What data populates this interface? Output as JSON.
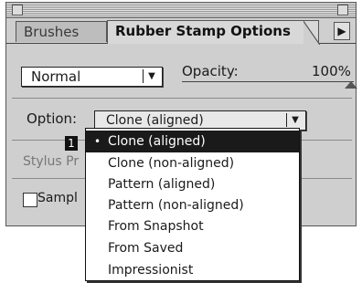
{
  "tabs": [
    {
      "label": "Brushes"
    },
    {
      "label": "Rubber Stamp Options"
    }
  ],
  "tab_scroll_icon": "right-triangle-icon",
  "blend_mode": {
    "value": "Normal"
  },
  "opacity": {
    "label": "Opacity:",
    "value": "100%"
  },
  "option": {
    "label": "Option:",
    "value": "Clone (aligned)"
  },
  "stylus": {
    "label": "Stylus Pr",
    "badge": "1"
  },
  "sample": {
    "label": "Sampl",
    "checked": false
  },
  "menu": {
    "bullet": "•",
    "items": [
      "Clone (aligned)",
      "Clone (non-aligned)",
      "Pattern (aligned)",
      "Pattern (non-aligned)",
      "From Snapshot",
      "From Saved",
      "Impressionist"
    ],
    "selected_index": 0
  },
  "colors": {
    "panel": "#cfcfcf",
    "highlight": "#1a1a1a"
  }
}
